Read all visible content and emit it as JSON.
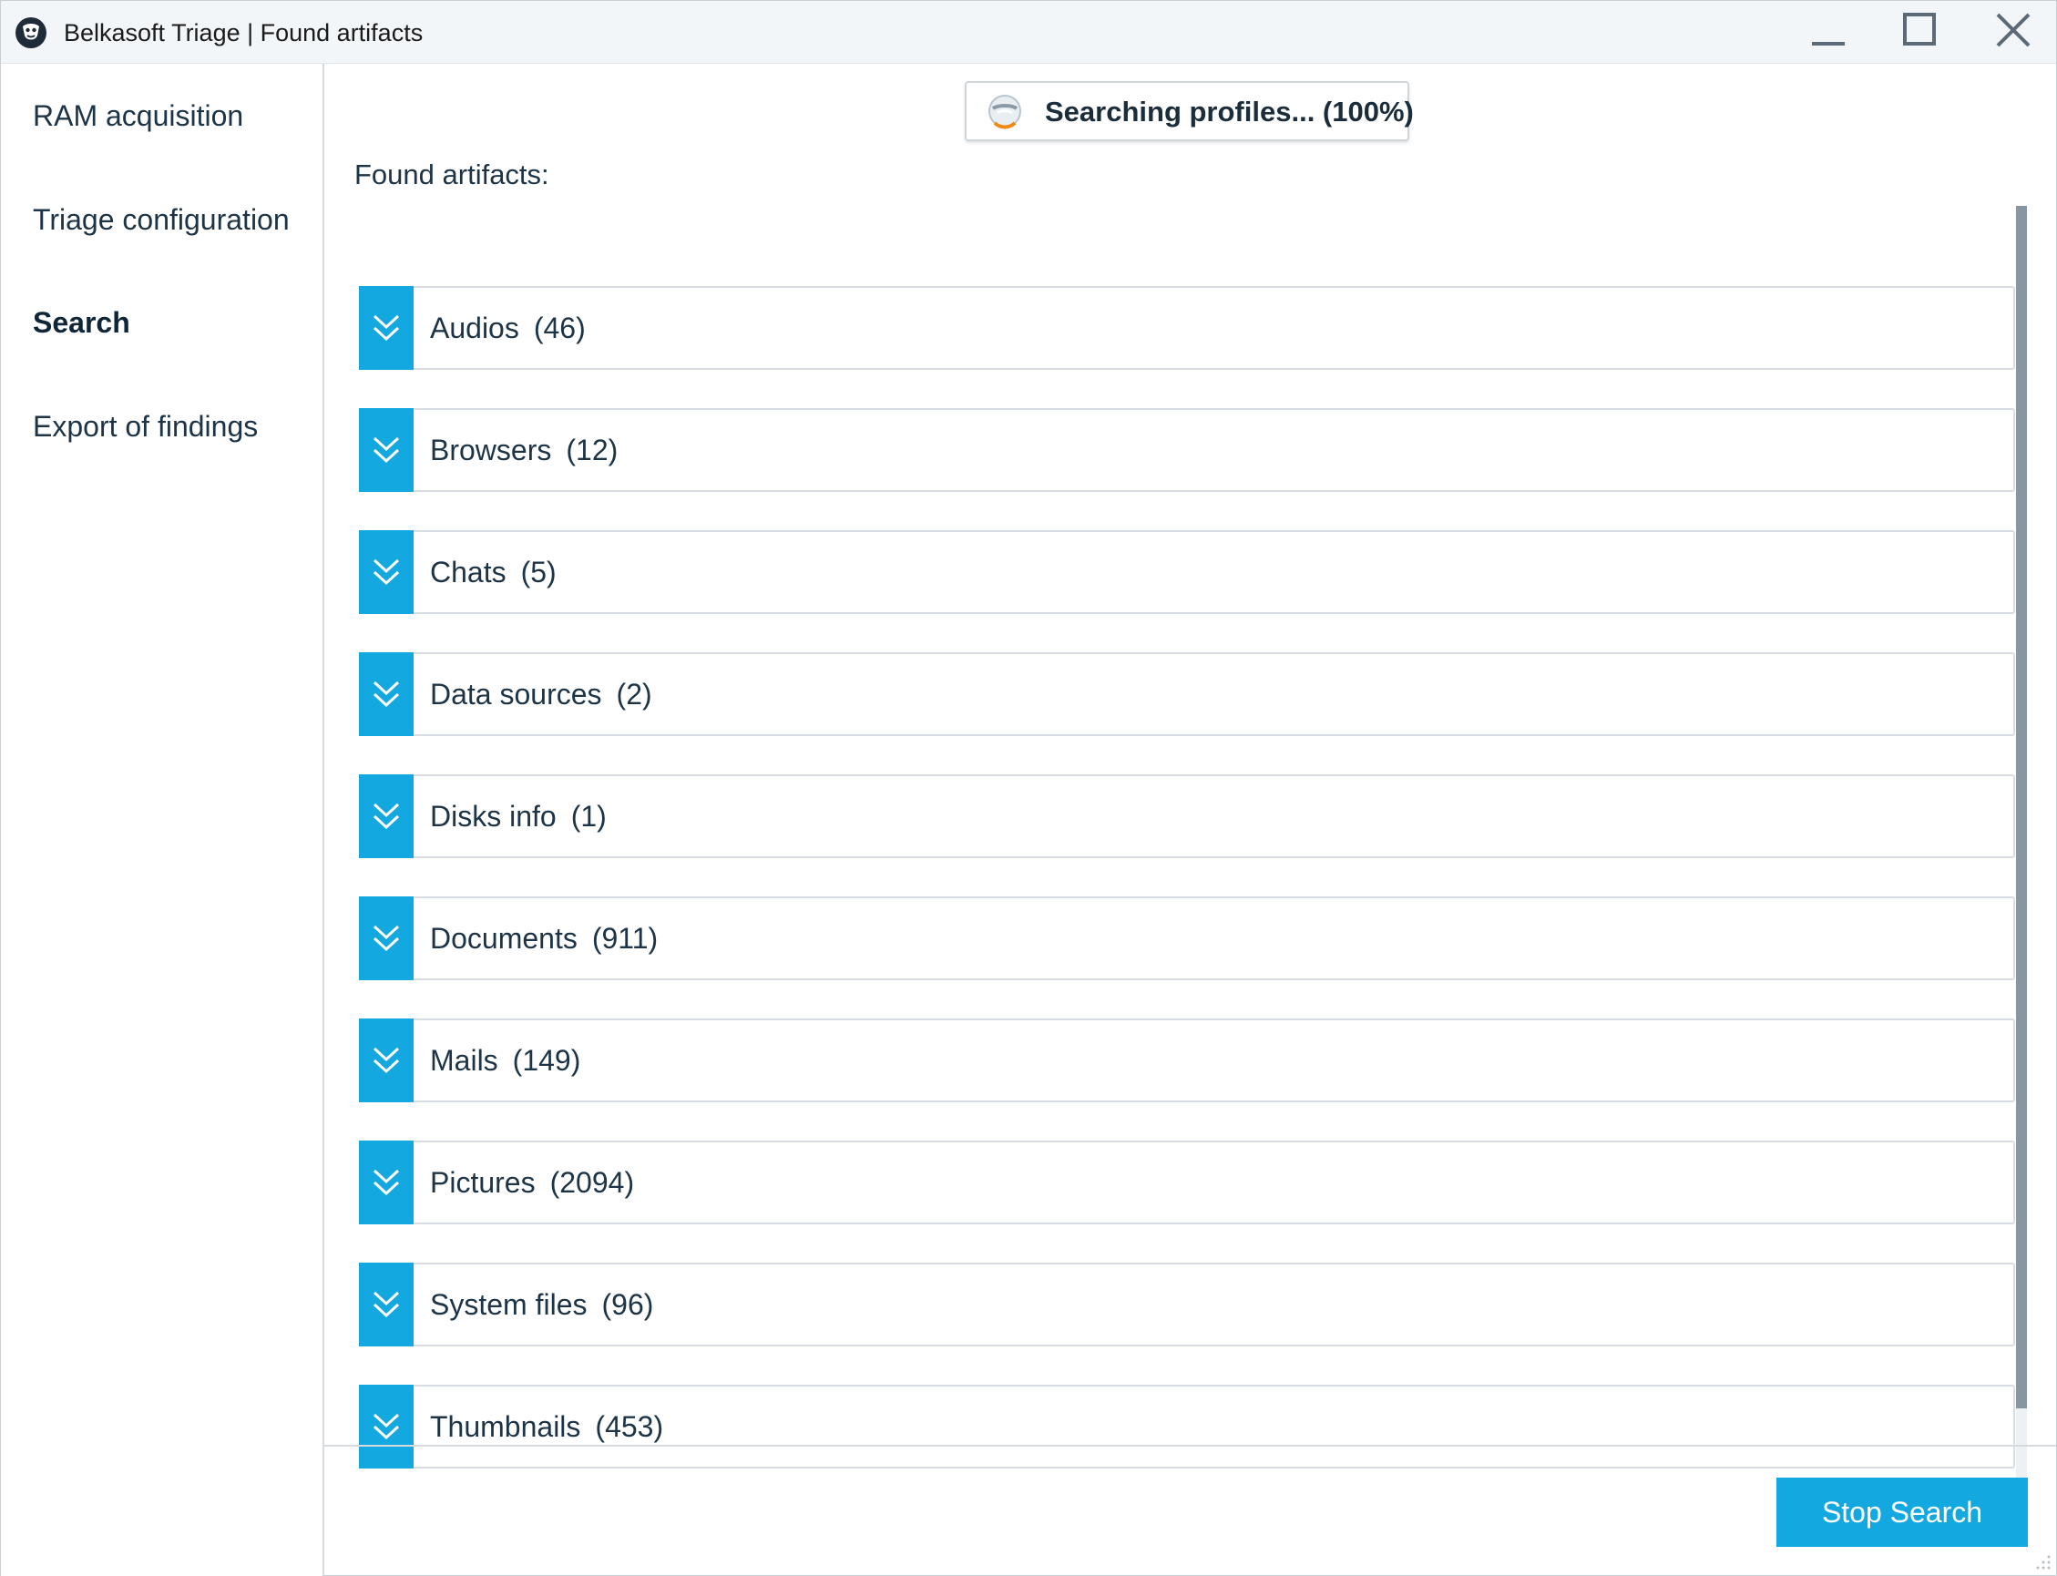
{
  "window": {
    "title": "Belkasoft Triage | Found artifacts"
  },
  "sidebar": {
    "items": [
      {
        "label": "RAM acquisition",
        "active": false
      },
      {
        "label": "Triage configuration",
        "active": false
      },
      {
        "label": "Search",
        "active": true
      },
      {
        "label": "Export of findings",
        "active": false
      }
    ]
  },
  "status": {
    "text": "Searching profiles... (100%)",
    "progress_percent": 100
  },
  "main": {
    "found_label": "Found artifacts:",
    "artifacts": [
      {
        "name": "Audios",
        "count": "(46)"
      },
      {
        "name": "Browsers",
        "count": "(12)"
      },
      {
        "name": "Chats",
        "count": "(5)"
      },
      {
        "name": "Data sources",
        "count": "(2)"
      },
      {
        "name": "Disks info",
        "count": "(1)"
      },
      {
        "name": "Documents",
        "count": "(911)"
      },
      {
        "name": "Mails",
        "count": "(149)"
      },
      {
        "name": "Pictures",
        "count": "(2094)"
      },
      {
        "name": "System files",
        "count": "(96)"
      },
      {
        "name": "Thumbnails",
        "count": "(453)"
      }
    ]
  },
  "footer": {
    "stop_label": "Stop Search"
  },
  "colors": {
    "accent": "#14a8e0",
    "scrollbar_thumb": "#8697a3",
    "text": "#1d3447"
  },
  "icons": {
    "app": "belkasoft-logo-icon",
    "expander": "double-chevron-down-icon",
    "status": "search-progress-icon"
  }
}
